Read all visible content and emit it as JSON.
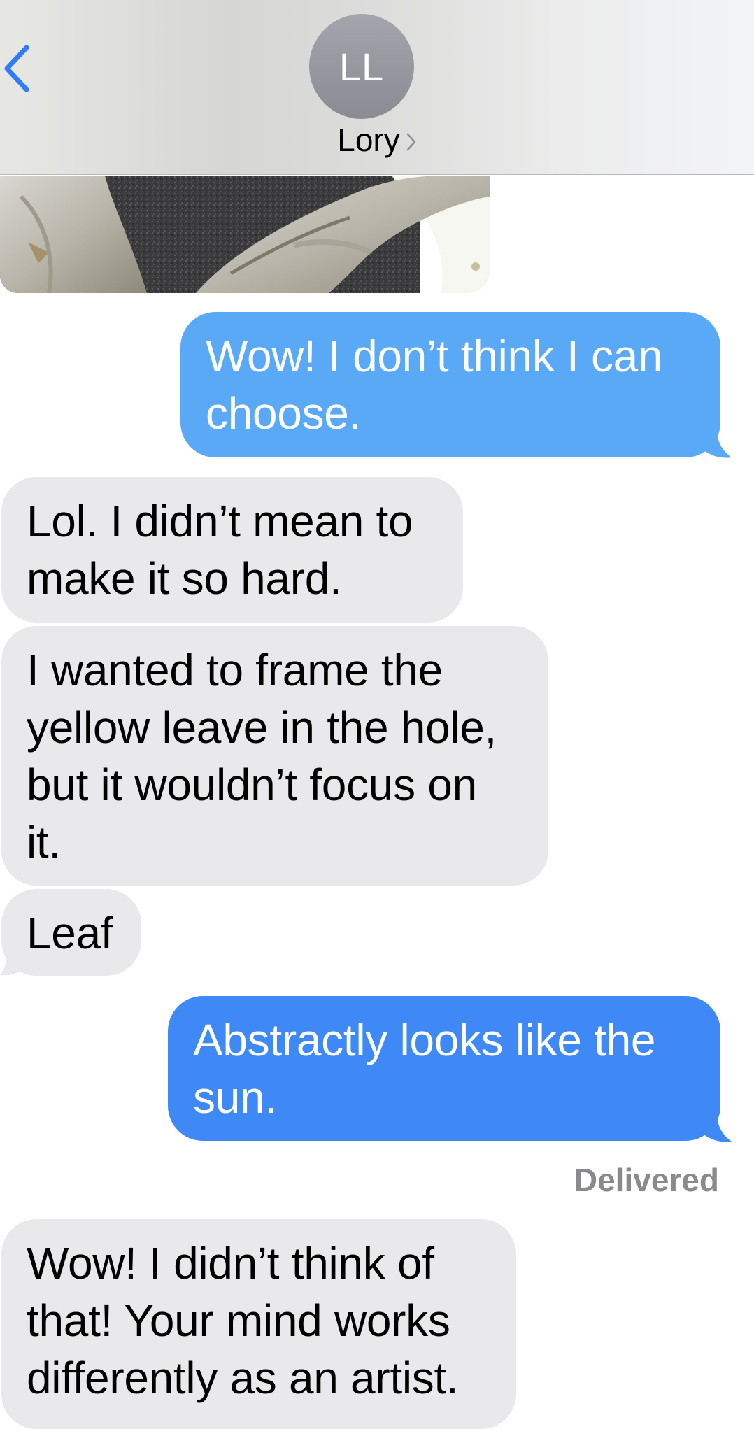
{
  "header": {
    "avatar_initials": "LL",
    "contact_name": "Lory",
    "accent_color": "#2f7cf6"
  },
  "messages": [
    {
      "sender": "me",
      "text": "Wow! I don’t think I can\nchoose.",
      "color": "#5aa9f7"
    },
    {
      "sender": "them",
      "text": "Lol. I didn’t mean to\nmake it so hard."
    },
    {
      "sender": "them",
      "text": "I wanted to frame the\nyellow leave in the hole,\nbut it wouldn’t focus on\nit."
    },
    {
      "sender": "them",
      "text": "Leaf"
    },
    {
      "sender": "me",
      "text": "Abstractly looks like the\nsun.",
      "color": "#3e89f5"
    },
    {
      "sender": "them",
      "text": "Wow! I didn’t think of\nthat! Your mind works\ndifferently as an artist."
    }
  ],
  "status": {
    "delivered_label": "Delivered"
  },
  "icons": {
    "back": "chevron-left-icon",
    "name_chevron": "chevron-right-icon"
  }
}
